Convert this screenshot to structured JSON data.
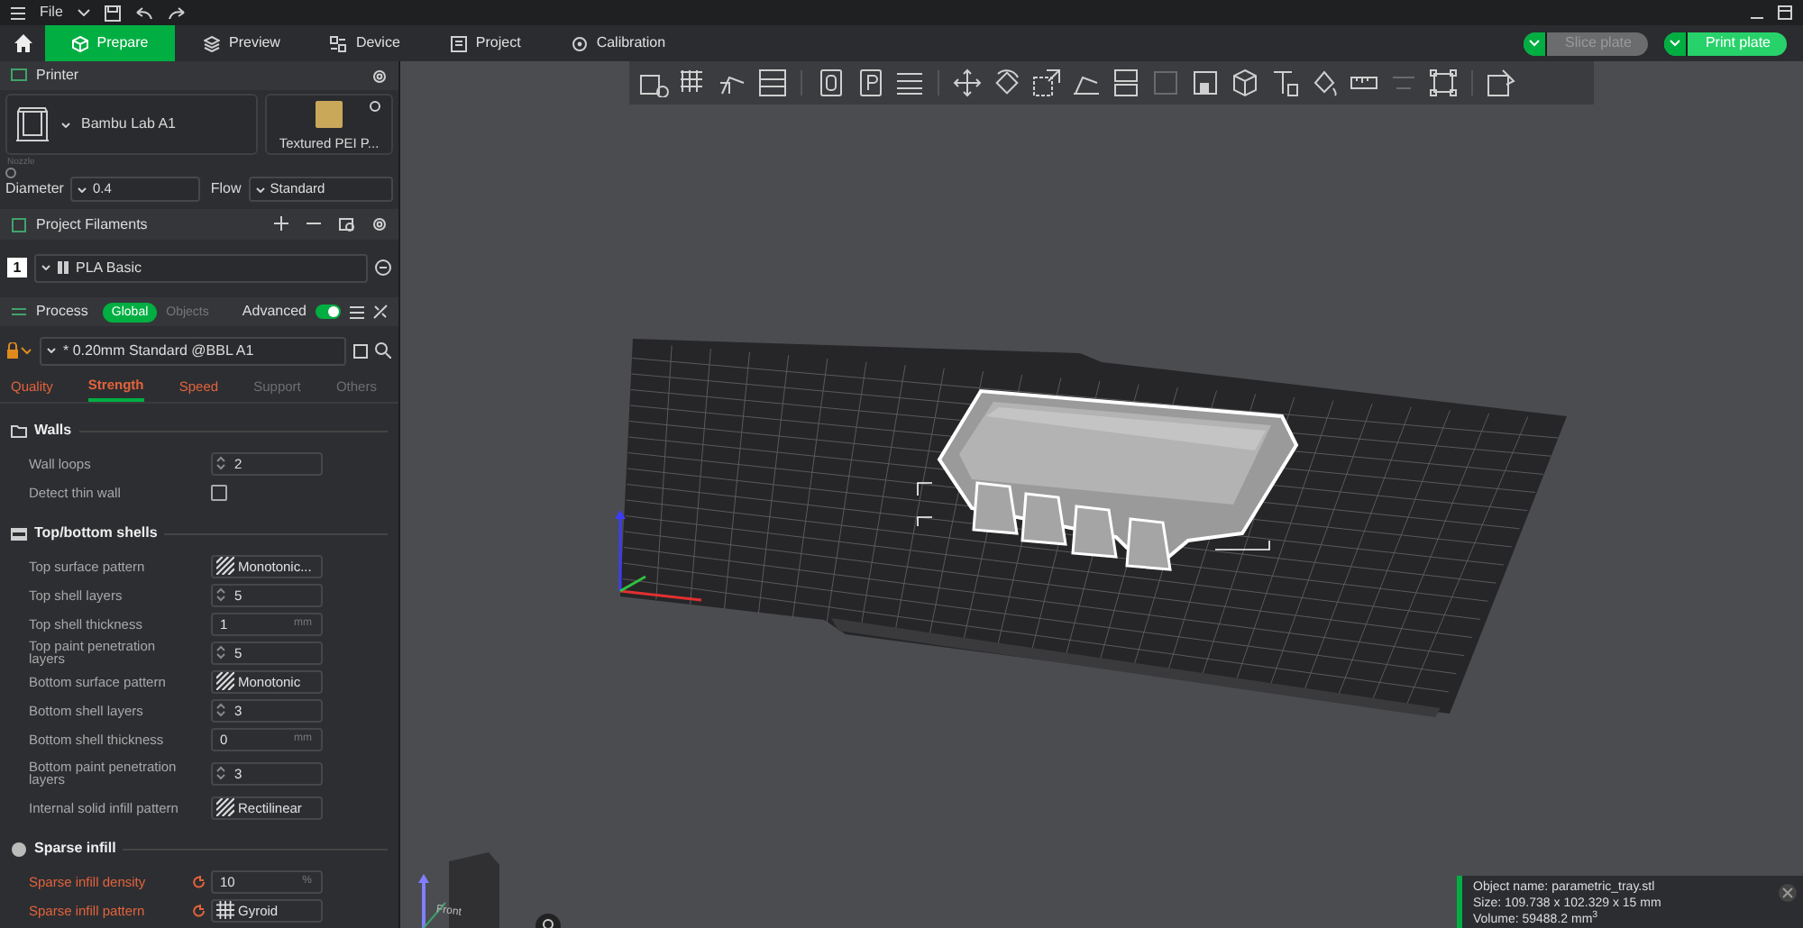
{
  "menu": {
    "file": "File"
  },
  "tabs": [
    {
      "label": "Prepare",
      "selected": true,
      "kind": "cube"
    },
    {
      "label": "Preview",
      "selected": false,
      "kind": "layers"
    },
    {
      "label": "Device",
      "selected": false,
      "kind": "device"
    },
    {
      "label": "Project",
      "selected": false,
      "kind": "project"
    },
    {
      "label": "Calibration",
      "selected": false,
      "kind": "calibration"
    }
  ],
  "actions": [
    {
      "label": "Slice plate",
      "disabled": true
    },
    {
      "label": "Print plate",
      "disabled": false
    }
  ],
  "printer": {
    "title": "Printer",
    "name": "Bambu Lab A1",
    "plate": "Textured PEI P...",
    "nozzle_label": "Nozzle",
    "diameter_label": "Diameter",
    "diameter": "0.4",
    "flow_label": "Flow",
    "flow": "Standard"
  },
  "filaments": {
    "title": "Project Filaments",
    "items": [
      {
        "index": "1",
        "name": "PLA Basic"
      }
    ]
  },
  "process": {
    "title": "Process",
    "scopes": [
      {
        "label": "Global",
        "selected": true
      },
      {
        "label": "Objects",
        "selected": false
      }
    ],
    "advanced_label": "Advanced",
    "advanced": true,
    "preset": "* 0.20mm Standard @BBL A1",
    "tabs": [
      {
        "label": "Quality",
        "selected": false,
        "modified": true
      },
      {
        "label": "Strength",
        "selected": true,
        "modified": true
      },
      {
        "label": "Speed",
        "selected": false,
        "modified": true
      },
      {
        "label": "Support",
        "selected": false,
        "modified": false
      },
      {
        "label": "Others",
        "selected": false,
        "modified": false
      }
    ]
  },
  "sections": [
    {
      "title": "Walls",
      "kind": "walls",
      "options": [
        {
          "label": "Wall loops",
          "kind": "spin",
          "value": "2",
          "modified": false
        },
        {
          "label": "Detect thin wall",
          "kind": "checkbox",
          "checked": false,
          "modified": false
        }
      ]
    },
    {
      "title": "Top/bottom shells",
      "kind": "shells",
      "options": [
        {
          "label": "Top surface pattern",
          "kind": "pattern",
          "value": "Monotonic...",
          "modified": false
        },
        {
          "label": "Top shell layers",
          "kind": "spin",
          "value": "5",
          "modified": false
        },
        {
          "label": "Top shell thickness",
          "kind": "number",
          "value": "1",
          "unit": "mm",
          "modified": false
        },
        {
          "label": "Top paint penetration layers",
          "kind": "spin",
          "value": "5",
          "modified": false
        },
        {
          "label": "Bottom surface pattern",
          "kind": "pattern",
          "value": "Monotonic",
          "modified": false
        },
        {
          "label": "Bottom shell layers",
          "kind": "spin",
          "value": "3",
          "modified": false
        },
        {
          "label": "Bottom shell thickness",
          "kind": "number",
          "value": "0",
          "unit": "mm",
          "modified": false
        },
        {
          "label": "Bottom paint penetration layers",
          "kind": "spin",
          "value": "3",
          "modified": false
        },
        {
          "label": "Internal solid infill pattern",
          "kind": "pattern",
          "value": "Rectilinear",
          "modified": false
        }
      ]
    },
    {
      "title": "Sparse infill",
      "kind": "infill",
      "options": [
        {
          "label": "Sparse infill density",
          "kind": "number",
          "value": "10",
          "unit": "%",
          "modified": true
        },
        {
          "label": "Sparse infill pattern",
          "kind": "pattern",
          "value": "Gyroid",
          "modified": true
        }
      ]
    }
  ],
  "view_cube": {
    "label": "Front"
  },
  "object_info": [
    "Object name: parametric_tray.stl",
    "Size: 109.738 x 102.329 x 15 mm",
    "Volume: 59488.2 mm$^{3}$"
  ]
}
